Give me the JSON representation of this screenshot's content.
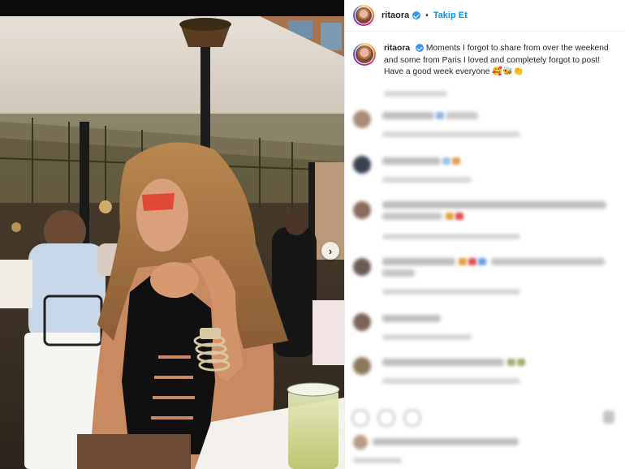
{
  "post": {
    "username": "ritaora",
    "follow_label": "Takip Et",
    "separator": "•",
    "caption": "Moments I forgot to share from over the weekend and some from Paris I loved and completely forgot to post! Have a good week everyone",
    "caption_emojis": "🥰🐝👏"
  },
  "carousel": {
    "next_glyph": "›"
  },
  "colors": {
    "accent": "#0095f6",
    "verified": "#3897f0",
    "text": "#262626"
  },
  "icons": {
    "verified": "verified-badge-icon",
    "next": "chevron-right-icon",
    "like": "heart-icon",
    "comment": "comment-icon",
    "share": "share-icon"
  }
}
